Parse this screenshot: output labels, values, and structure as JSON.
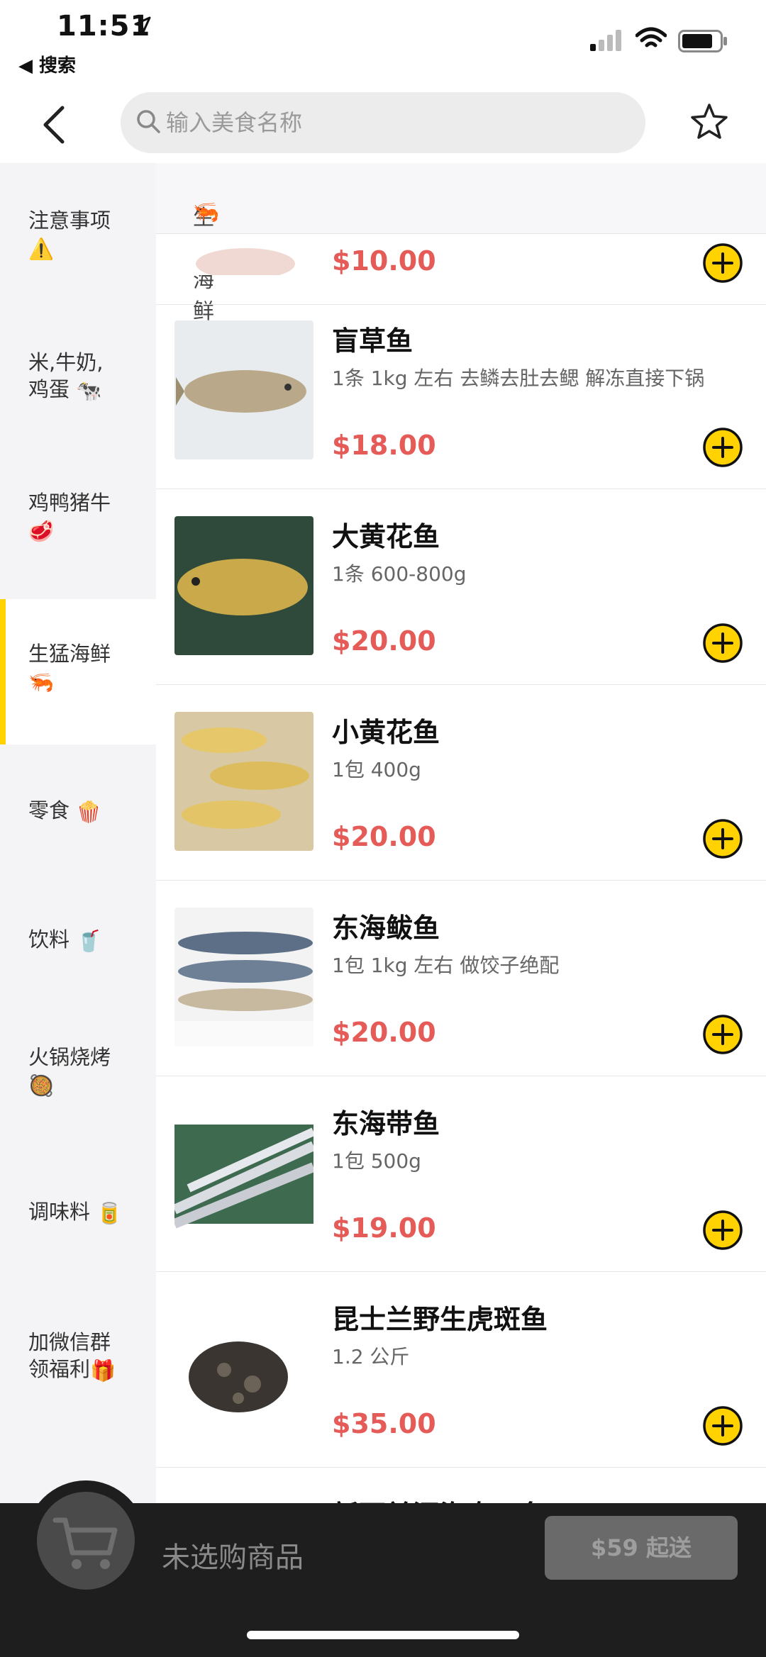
{
  "status_bar": {
    "time": "11:51",
    "back_app": "◀ 搜索"
  },
  "nav": {
    "search_placeholder": "输入美食名称"
  },
  "sidebar": {
    "items": [
      {
        "label": "注意事项",
        "emoji": "⚠️"
      },
      {
        "label": "米,牛奶,鸡蛋",
        "emoji": "🐄"
      },
      {
        "label": "鸡鸭猪牛",
        "emoji": "🥩"
      },
      {
        "label": "生猛海鲜",
        "emoji": "🦐"
      },
      {
        "label": "零食",
        "emoji": "🍿"
      },
      {
        "label": "饮料",
        "emoji": "🥤"
      },
      {
        "label": "火锅烧烤",
        "emoji": "🥘"
      },
      {
        "label": "调味料",
        "emoji": "🥫"
      },
      {
        "label": "加微信群领福利",
        "emoji": "🎁"
      }
    ],
    "active_index": 3
  },
  "section": {
    "title": "生猛海鲜",
    "emoji": "🦐"
  },
  "products": [
    {
      "name": "",
      "desc": "",
      "price": "$10.00"
    },
    {
      "name": "盲草鱼",
      "desc": "1条 1kg 左右 去鳞去肚去鳃 解冻直接下锅",
      "price": "$18.00"
    },
    {
      "name": "大黄花鱼",
      "desc": "1条 600-800g",
      "price": "$20.00"
    },
    {
      "name": "小黄花鱼",
      "desc": "1包 400g",
      "price": "$20.00"
    },
    {
      "name": "东海鲅鱼",
      "desc": "1包 1kg 左右 做饺子绝配",
      "price": "$20.00"
    },
    {
      "name": "东海带鱼",
      "desc": "1包 500g",
      "price": "$19.00"
    },
    {
      "name": "昆士兰野生虎斑鱼",
      "desc": "1.2 公斤",
      "price": "$35.00"
    },
    {
      "name": "新西兰深海专口鱼",
      "desc": "",
      "price": ""
    }
  ],
  "cart": {
    "empty_text": "未选购商品",
    "min_order": "$59 起送"
  },
  "colors": {
    "accent": "#ffd200",
    "price": "#e45b57",
    "cartbar": "#1e1e1e"
  }
}
